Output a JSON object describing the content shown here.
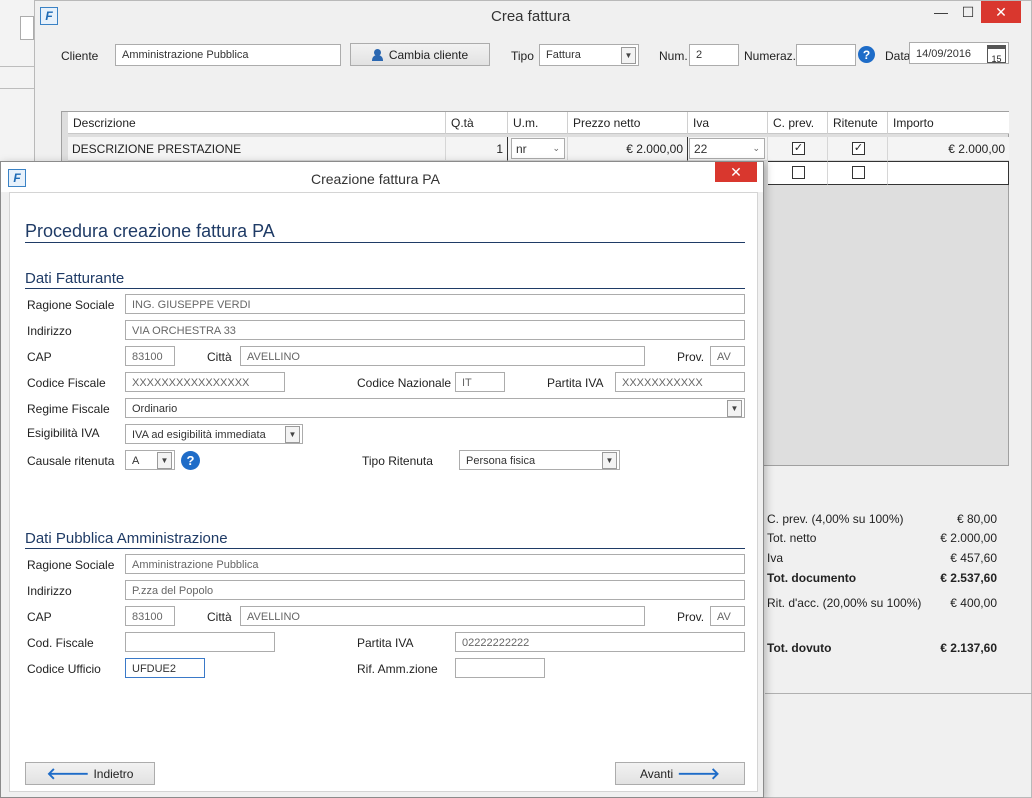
{
  "main_window": {
    "app_icon": "F",
    "title": "Crea fattura",
    "minimize": "—",
    "maximize": "☐",
    "close": "✕",
    "cliente_label": "Cliente",
    "cliente_value": "Amministrazione Pubblica",
    "cambia_cliente": "Cambia cliente",
    "tipo_label": "Tipo",
    "tipo_value": "Fattura",
    "num_label": "Num.",
    "num_value": "2",
    "numeraz_label": "Numeraz.",
    "numeraz_value": "",
    "data_label": "Data",
    "data_value": "14/09/2016",
    "calendar_day": "15"
  },
  "grid": {
    "headers": [
      "Descrizione",
      "Q.tà",
      "U.m.",
      "Prezzo netto",
      "Iva",
      "C. prev.",
      "Ritenute",
      "Importo"
    ],
    "rows": [
      {
        "descrizione": "DESCRIZIONE PRESTAZIONE",
        "qta": "1",
        "um": "nr",
        "prezzo": "€ 2.000,00",
        "iva": "22",
        "cprev": true,
        "ritenute": true,
        "importo": "€ 2.000,00"
      },
      {
        "descrizione": "",
        "qta": "",
        "um": "",
        "prezzo": "",
        "iva": "",
        "cprev": false,
        "ritenute": false,
        "importo": ""
      }
    ]
  },
  "totals": [
    {
      "label": "C. prev. (4,00% su 100%)",
      "value": "€ 80,00",
      "bold": false
    },
    {
      "label": "Tot. netto",
      "value": "€ 2.000,00",
      "bold": false
    },
    {
      "label": "Iva",
      "value": "€ 457,60",
      "bold": false
    },
    {
      "label": "Tot. documento",
      "value": "€ 2.537,60",
      "bold": true
    },
    {
      "label": "Rit. d'acc. (20,00% su 100%)",
      "value": "€ 400,00",
      "bold": false
    },
    {
      "label": "Tot. dovuto",
      "value": "€ 2.137,60",
      "bold": true
    }
  ],
  "dialog": {
    "app_icon": "F",
    "title": "Creazione fattura PA",
    "close": "✕",
    "heading": "Procedura creazione fattura PA",
    "fatturante": {
      "section": "Dati Fatturante",
      "ragione_sociale_label": "Ragione Sociale",
      "ragione_sociale": "ING. GIUSEPPE VERDI",
      "indirizzo_label": "Indirizzo",
      "indirizzo": "VIA ORCHESTRA 33",
      "cap_label": "CAP",
      "cap": "83100",
      "citta_label": "Città",
      "citta": "AVELLINO",
      "prov_label": "Prov.",
      "prov": "AV",
      "cf_label": "Codice Fiscale",
      "cf": "XXXXXXXXXXXXXXXX",
      "cod_naz_label": "Codice Nazionale",
      "cod_naz": "IT",
      "piva_label": "Partita IVA",
      "piva": "XXXXXXXXXXX",
      "regime_label": "Regime Fiscale",
      "regime": "Ordinario",
      "esig_label": "Esigibilità IVA",
      "esig": "IVA ad esigibilità immediata",
      "causale_label": "Causale ritenuta",
      "causale": "A",
      "tipo_rit_label": "Tipo Ritenuta",
      "tipo_rit": "Persona fisica"
    },
    "pa": {
      "section": "Dati Pubblica Amministrazione",
      "ragione_sociale_label": "Ragione Sociale",
      "ragione_sociale": "Amministrazione Pubblica",
      "indirizzo_label": "Indirizzo",
      "indirizzo": "P.zza del Popolo",
      "cap_label": "CAP",
      "cap": "83100",
      "citta_label": "Città",
      "citta": "AVELLINO",
      "prov_label": "Prov.",
      "prov": "AV",
      "cf_label": "Cod. Fiscale",
      "cf": "",
      "piva_label": "Partita IVA",
      "piva": "02222222222",
      "cod_uff_label": "Codice Ufficio",
      "cod_uff": "UFDUE2",
      "rif_label": "Rif. Amm.zione",
      "rif": ""
    },
    "back": "Indietro",
    "next": "Avanti"
  },
  "colors": {
    "accent": "#1f3b66",
    "close": "#d9372e",
    "help": "#1e6cc8"
  }
}
